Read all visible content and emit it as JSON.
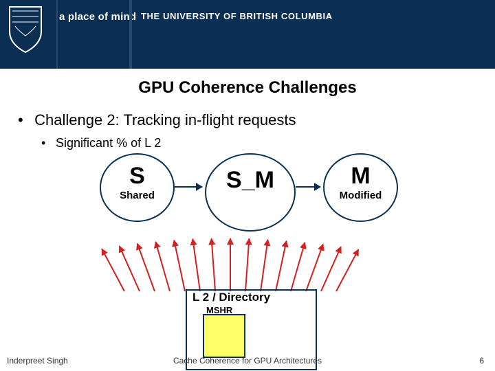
{
  "header": {
    "tagline": "a place of mind",
    "university": "THE UNIVERSITY OF BRITISH COLUMBIA"
  },
  "slide": {
    "title": "GPU Coherence Challenges",
    "bullet1": "Challenge 2: Tracking in-flight requests",
    "bullet2": "Significant % of L 2",
    "stateS": {
      "label": "S",
      "sub": "Shared"
    },
    "stateSM": {
      "label": "S_M",
      "sub": ""
    },
    "stateM": {
      "label": "M",
      "sub": "Modified"
    },
    "dir_label": "L 2 / Directory",
    "mshr_label": "MSHR"
  },
  "footer": {
    "author": "Inderpreet Singh",
    "center": "Cache Coherence for GPU Architectures",
    "page": "6"
  },
  "colors": {
    "brand": "#0a2f52",
    "accent_red": "#d21f1f",
    "mshr_bg": "#ffff66"
  }
}
